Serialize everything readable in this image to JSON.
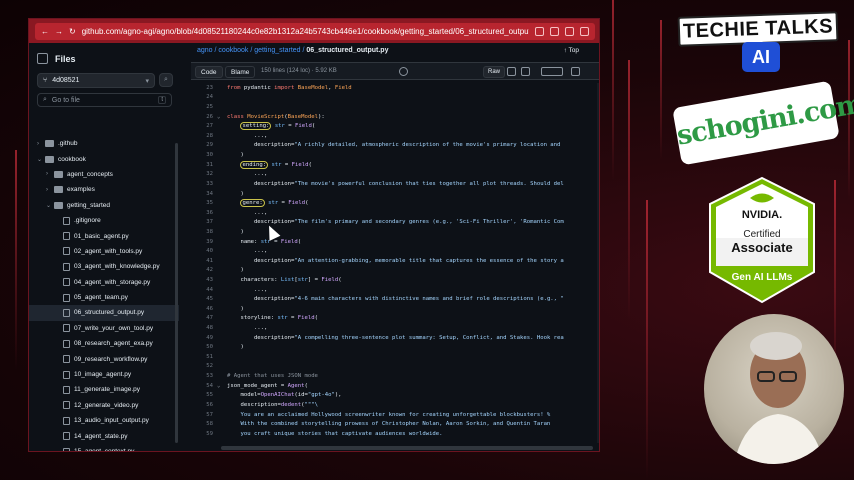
{
  "browser": {
    "url": "github.com/agno-agi/agno/blob/4d08521180244c0e82b1312a24b5743cb446e1/cookbook/getting_started/06_structured_output.py"
  },
  "sidebar": {
    "title": "Files",
    "branch": "4d08521",
    "goto_placeholder": "Go to file",
    "goto_key": "t",
    "items": [
      {
        "label": ".github",
        "kind": "folder",
        "depth": 1,
        "open": false
      },
      {
        "label": "cookbook",
        "kind": "folder",
        "depth": 1,
        "open": true
      },
      {
        "label": "agent_concepts",
        "kind": "folder",
        "depth": 2,
        "open": false
      },
      {
        "label": "examples",
        "kind": "folder",
        "depth": 2,
        "open": false
      },
      {
        "label": "getting_started",
        "kind": "folder",
        "depth": 2,
        "open": true
      },
      {
        "label": ".gitignore",
        "kind": "file",
        "depth": 3
      },
      {
        "label": "01_basic_agent.py",
        "kind": "file",
        "depth": 3
      },
      {
        "label": "02_agent_with_tools.py",
        "kind": "file",
        "depth": 3
      },
      {
        "label": "03_agent_with_knowledge.py",
        "kind": "file",
        "depth": 3
      },
      {
        "label": "04_agent_with_storage.py",
        "kind": "file",
        "depth": 3
      },
      {
        "label": "05_agent_team.py",
        "kind": "file",
        "depth": 3
      },
      {
        "label": "06_structured_output.py",
        "kind": "file",
        "depth": 3,
        "selected": true
      },
      {
        "label": "07_write_your_own_tool.py",
        "kind": "file",
        "depth": 3
      },
      {
        "label": "08_research_agent_exa.py",
        "kind": "file",
        "depth": 3
      },
      {
        "label": "09_research_workflow.py",
        "kind": "file",
        "depth": 3
      },
      {
        "label": "10_image_agent.py",
        "kind": "file",
        "depth": 3
      },
      {
        "label": "11_generate_image.py",
        "kind": "file",
        "depth": 3
      },
      {
        "label": "12_generate_video.py",
        "kind": "file",
        "depth": 3
      },
      {
        "label": "13_audio_input_output.py",
        "kind": "file",
        "depth": 3
      },
      {
        "label": "14_agent_state.py",
        "kind": "file",
        "depth": 3
      },
      {
        "label": "15_agent_context.py",
        "kind": "file",
        "depth": 3
      },
      {
        "label": "16_agent_session.py",
        "kind": "file",
        "depth": 3
      }
    ]
  },
  "breadcrumb": {
    "repo": "agno",
    "sep": " / ",
    "p1": "cookbook",
    "p2": "getting_started",
    "file": "06_structured_output.py"
  },
  "top_label": "Top",
  "toolbar": {
    "code": "Code",
    "blame": "Blame",
    "meta": "150 lines (124 loc) · 5.92 KB",
    "raw": "Raw"
  },
  "code_lines": [
    {
      "n": "23",
      "html": "<span class='kw'>from</span> pydantic <span class='kw'>import</span> <span class='cl'>BaseModel</span>, <span class='cl'>Field</span>"
    },
    {
      "n": "24",
      "html": ""
    },
    {
      "n": "25",
      "html": ""
    },
    {
      "n": "26",
      "f": "⌄",
      "html": "<span class='kw'>class</span> <span class='cl'>MovieScript</span>(<span class='cl'>BaseModel</span>):"
    },
    {
      "n": "27",
      "html": "    <span class='circ'>setting:</span> <span class='nm'>str</span> = <span class='fn'>Field</span>("
    },
    {
      "n": "28",
      "html": "        ...,"
    },
    {
      "n": "29",
      "html": "        description=<span class='st'>\"A richly detailed, atmospheric description of the movie's primary location and</span>"
    },
    {
      "n": "30",
      "html": "    )"
    },
    {
      "n": "31",
      "html": "    <span class='circ'>ending:</span> <span class='nm'>str</span> = <span class='fn'>Field</span>("
    },
    {
      "n": "32",
      "html": "        ...,"
    },
    {
      "n": "33",
      "html": "        description=<span class='st'>\"The movie's powerful conclusion that ties together all plot threads. Should del</span>"
    },
    {
      "n": "34",
      "html": "    )"
    },
    {
      "n": "35",
      "html": "    <span class='circ'>genre:</span> <span class='nm'>str</span> = <span class='fn'>Field</span>("
    },
    {
      "n": "36",
      "html": "        ...,"
    },
    {
      "n": "37",
      "html": "        description=<span class='st'>\"The film's primary and secondary genres (e.g., 'Sci-Fi Thriller', 'Romantic Com</span>"
    },
    {
      "n": "38",
      "html": "    )"
    },
    {
      "n": "39",
      "html": "    name: <span class='nm'>str</span> = <span class='fn'>Field</span>("
    },
    {
      "n": "40",
      "html": "        ...,"
    },
    {
      "n": "41",
      "html": "        description=<span class='st'>\"An attention-grabbing, memorable title that captures the essence of the story a</span>"
    },
    {
      "n": "42",
      "html": "    )"
    },
    {
      "n": "43",
      "html": "    characters: <span class='nm'>List</span>[<span class='nm'>str</span>] = <span class='fn'>Field</span>("
    },
    {
      "n": "44",
      "html": "        ...,"
    },
    {
      "n": "45",
      "html": "        description=<span class='st'>\"4-6 main characters with distinctive names and brief role descriptions (e.g., \"</span>"
    },
    {
      "n": "46",
      "html": "    )"
    },
    {
      "n": "47",
      "html": "    storyline: <span class='nm'>str</span> = <span class='fn'>Field</span>("
    },
    {
      "n": "48",
      "html": "        ...,"
    },
    {
      "n": "49",
      "html": "        description=<span class='st'>\"A compelling three-sentence plot summary: Setup, Conflict, and Stakes. Hook rea</span>"
    },
    {
      "n": "50",
      "html": "    )"
    },
    {
      "n": "51",
      "html": ""
    },
    {
      "n": "52",
      "html": ""
    },
    {
      "n": "53",
      "html": "<span class='cm'># Agent that uses JSON mode</span>"
    },
    {
      "n": "54",
      "f": "⌄",
      "html": "json_mode_agent = <span class='fn'>Agent</span>("
    },
    {
      "n": "55",
      "html": "    model=<span class='fn'>OpenAIChat</span>(id=<span class='st'>\"gpt-4o\"</span>),"
    },
    {
      "n": "56",
      "html": "    description=<span class='fn'>dedent</span>(<span class='st'>\"\"\"\\</span>"
    },
    {
      "n": "57",
      "html": "<span class='st'>    You are an acclaimed Hollywood screenwriter known for creating unforgettable blockbusters! %</span>"
    },
    {
      "n": "58",
      "html": "<span class='st'>    With the combined storytelling prowess of Christopher Nolan, Aaron Sorkin, and Quentin Taran</span>"
    },
    {
      "n": "59",
      "html": "<span class='st'>    you craft unique stories that captivate audiences worldwide.</span>"
    }
  ],
  "overlay": {
    "techie": "TECHIE TALKS",
    "ai": "AI",
    "schogini": "schogini.com",
    "nvidia": "NVIDIA.",
    "certified": "Certified",
    "associate": "Associate",
    "genai": "Gen AI LLMs"
  },
  "colors": {
    "accent_link": "#4493f8",
    "badge_green": "#76b900",
    "frame_red": "#b8252f"
  }
}
